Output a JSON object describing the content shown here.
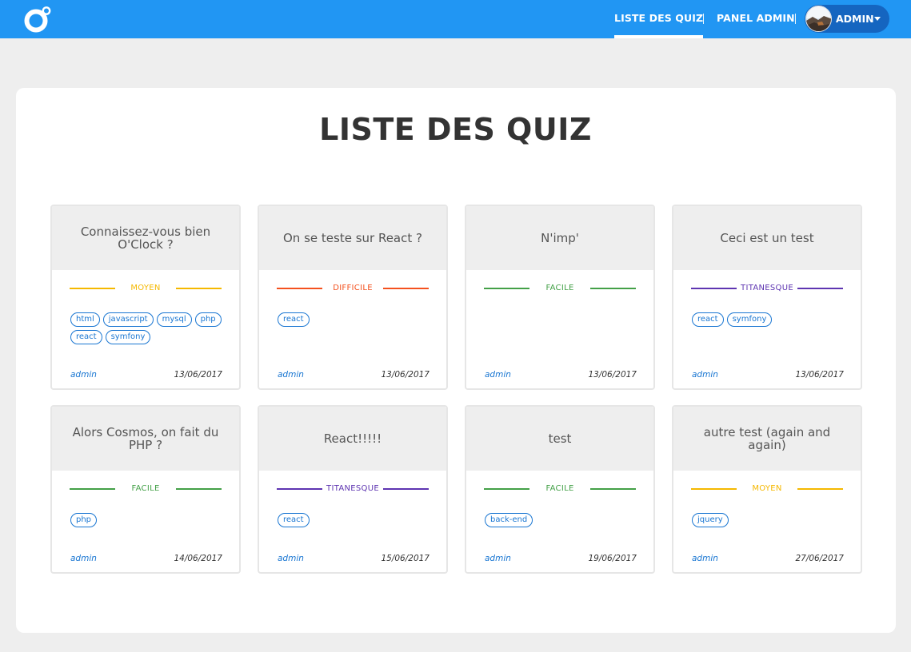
{
  "nav": {
    "links": [
      {
        "label": "LISTE DES QUIZ",
        "active": true
      },
      {
        "label": "PANEL ADMIN",
        "active": false
      }
    ],
    "user": {
      "name": "ADMIN"
    }
  },
  "colors": {
    "navbar": "#2196f3",
    "tag": "#1976d2",
    "moyen": "#f5b800",
    "difficile": "#f4511e",
    "facile": "#43a047",
    "titanesque": "#5e35b1"
  },
  "page": {
    "title": "LISTE DES QUIZ"
  },
  "quizzes": [
    {
      "title": "Connaissez-vous bien O'Clock ?",
      "level": "MOYEN",
      "level_color": "#f5b800",
      "tags": [
        "html",
        "javascript",
        "mysql",
        "php",
        "react",
        "symfony"
      ],
      "author": "admin",
      "date": "13/06/2017"
    },
    {
      "title": "On se teste sur React ?",
      "level": "DIFFICILE",
      "level_color": "#f4511e",
      "tags": [
        "react"
      ],
      "author": "admin",
      "date": "13/06/2017"
    },
    {
      "title": "N'imp'",
      "level": "FACILE",
      "level_color": "#43a047",
      "tags": [],
      "author": "admin",
      "date": "13/06/2017"
    },
    {
      "title": "Ceci est un test",
      "level": "TITANESQUE",
      "level_color": "#5e35b1",
      "tags": [
        "react",
        "symfony"
      ],
      "author": "admin",
      "date": "13/06/2017"
    },
    {
      "title": "Alors Cosmos, on fait du PHP ?",
      "level": "FACILE",
      "level_color": "#43a047",
      "tags": [
        "php"
      ],
      "author": "admin",
      "date": "14/06/2017"
    },
    {
      "title": "React!!!!!",
      "level": "TITANESQUE",
      "level_color": "#5e35b1",
      "tags": [
        "react"
      ],
      "author": "admin",
      "date": "15/06/2017"
    },
    {
      "title": "test",
      "level": "FACILE",
      "level_color": "#43a047",
      "tags": [
        "back-end"
      ],
      "author": "admin",
      "date": "19/06/2017"
    },
    {
      "title": "autre test (again and again)",
      "level": "MOYEN",
      "level_color": "#f5b800",
      "tags": [
        "jquery"
      ],
      "author": "admin",
      "date": "27/06/2017"
    }
  ]
}
